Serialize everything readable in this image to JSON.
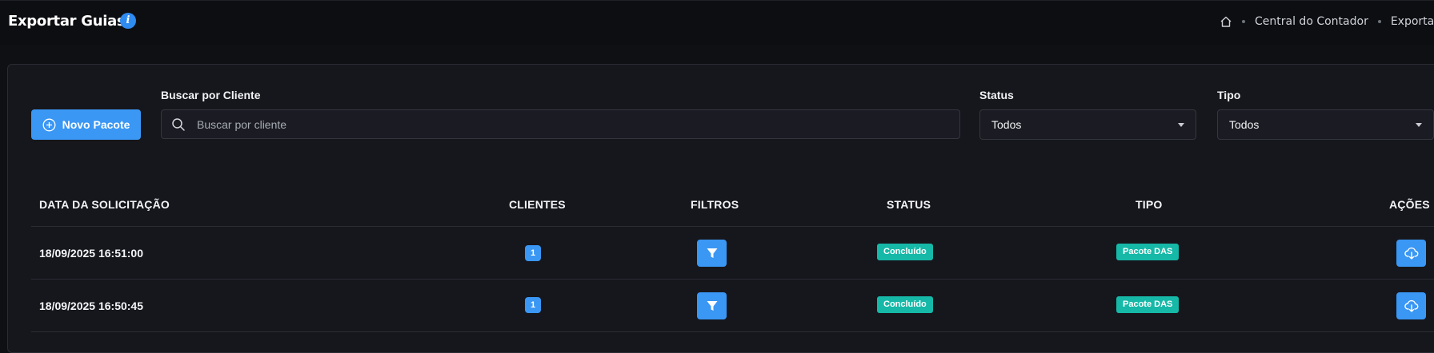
{
  "header": {
    "title": "Exportar Guias",
    "breadcrumb": [
      "Central do Contador",
      "Exportar Guias"
    ]
  },
  "toolbar": {
    "new_button": "Novo Pacote",
    "search_label": "Buscar por Cliente",
    "search_placeholder": "Buscar por cliente",
    "status_label": "Status",
    "status_value": "Todos",
    "type_label": "Tipo",
    "type_value": "Todos"
  },
  "table": {
    "columns": [
      "DATA DA SOLICITAÇÃO",
      "CLIENTES",
      "FILTROS",
      "STATUS",
      "TIPO",
      "AÇÕES"
    ],
    "rows": [
      {
        "date": "18/09/2025 16:51:00",
        "clients": "1",
        "status": "Concluído",
        "type": "Pacote DAS"
      },
      {
        "date": "18/09/2025 16:50:45",
        "clients": "1",
        "status": "Concluído",
        "type": "Pacote DAS"
      }
    ]
  },
  "colors": {
    "primary": "#3a97f4",
    "success": "#16b8a7",
    "background": "#0f1014",
    "card": "#16171d"
  },
  "icons": [
    "home-icon",
    "info-icon",
    "plus-circle-icon",
    "search-icon",
    "caret-down-icon",
    "filter-icon",
    "cloud-download-icon"
  ]
}
